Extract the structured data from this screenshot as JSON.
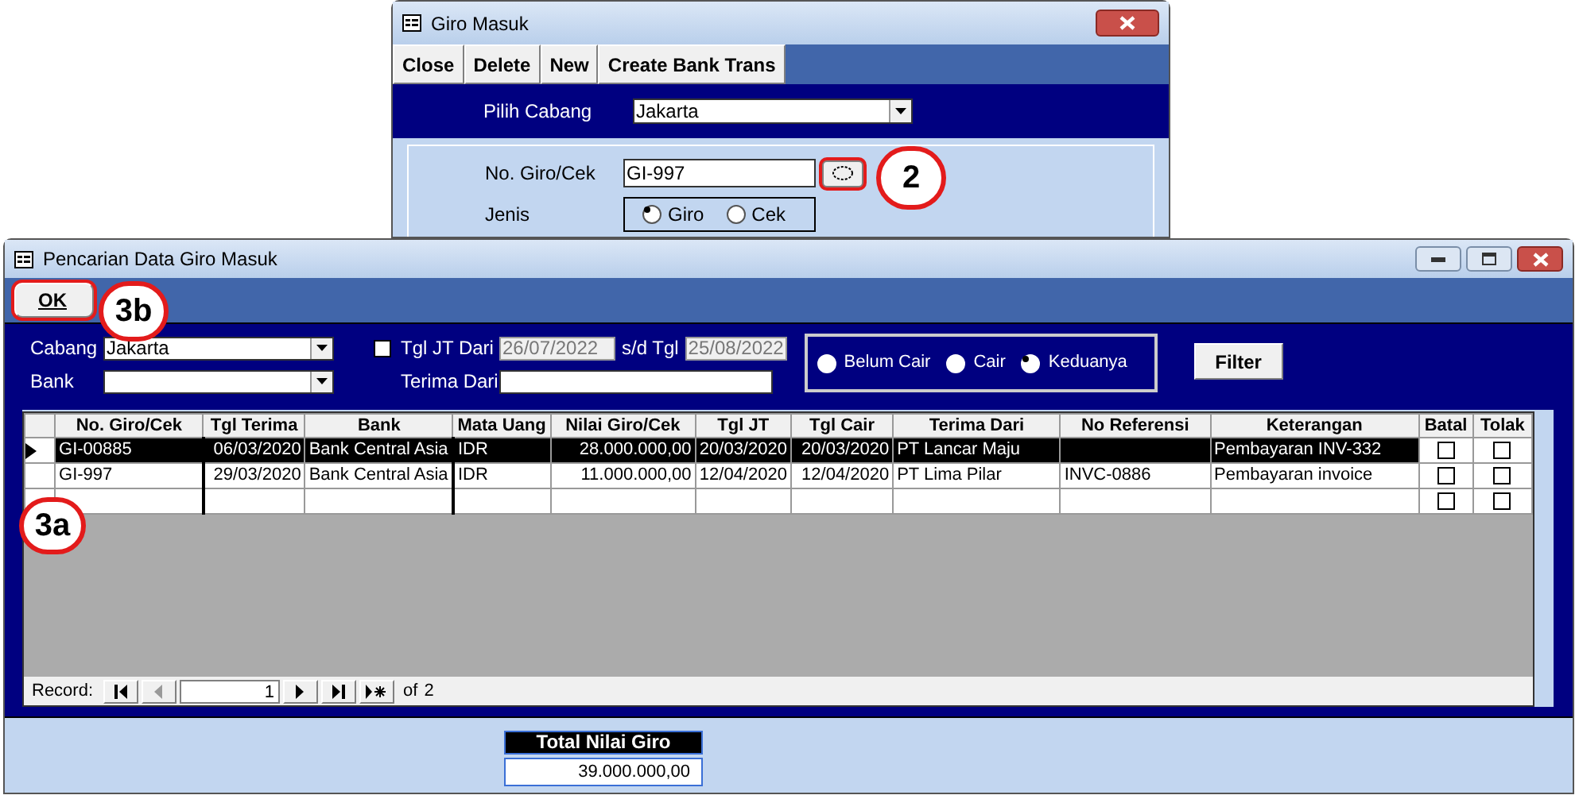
{
  "back_window": {
    "title": "Giro Masuk",
    "toolbar": [
      "Close",
      "Delete",
      "New",
      "Create Bank Trans"
    ],
    "branch_label": "Pilih Cabang",
    "branch_value": "Jakarta",
    "number_label": "No. Giro/Cek",
    "number_value": "GI-997",
    "type_label": "Jenis",
    "types": [
      {
        "label": "Giro",
        "selected": true
      },
      {
        "label": "Cek",
        "selected": false
      }
    ],
    "callout": "2"
  },
  "window": {
    "title": "Pencarian Data Giro Masuk",
    "toolbar": [
      "OK"
    ],
    "callout": "3b",
    "filters": {
      "branch_label": "Cabang",
      "branch_value": "Jakarta",
      "bank_label": "Bank",
      "date_checkbox": {
        "label": "Tgl JT Dari",
        "checked": false
      },
      "date_from": "26/07/2022",
      "date_to_label": "s/d Tgl",
      "date_to": "25/08/2022",
      "from_label": "Terima Dari",
      "status": [
        {
          "label": "Belum Cair",
          "selected": false
        },
        {
          "label": "Cair",
          "selected": false
        },
        {
          "label": "Keduanya",
          "selected": true
        }
      ],
      "filter_button": "Filter"
    },
    "table": {
      "columns": [
        "No. Giro/Cek",
        "Tgl Terima",
        "Bank",
        "Mata Uang",
        "Nilai Giro/Cek",
        "Tgl JT",
        "Tgl Cair",
        "Terima Dari",
        "No Referensi",
        "Keterangan",
        "Batal",
        "Tolak"
      ],
      "rows": [
        {
          "selected": true,
          "cells": [
            "GI-00885",
            "06/03/2020",
            "Bank Central Asia",
            "IDR",
            "28.000.000,00",
            "20/03/2020",
            "20/03/2020",
            "PT Lancar Maju",
            "",
            "Pembayaran INV-332"
          ],
          "batal": false,
          "tolak": false
        },
        {
          "selected": false,
          "cells": [
            "GI-997",
            "29/03/2020",
            "Bank Central Asia",
            "IDR",
            "11.000.000,00",
            "12/04/2020",
            "12/04/2020",
            "PT Lima Pilar",
            "INVC-0886",
            "Pembayaran invoice"
          ],
          "batal": false,
          "tolak": false
        }
      ],
      "new_row": {
        "batal": false,
        "tolak": false
      },
      "callout": "3a"
    },
    "navigator": {
      "label": "Record:",
      "current": "1",
      "total_label": "of",
      "total": "2"
    },
    "total": {
      "label": "Total Nilai Giro",
      "value": "39.000.000,00"
    }
  }
}
